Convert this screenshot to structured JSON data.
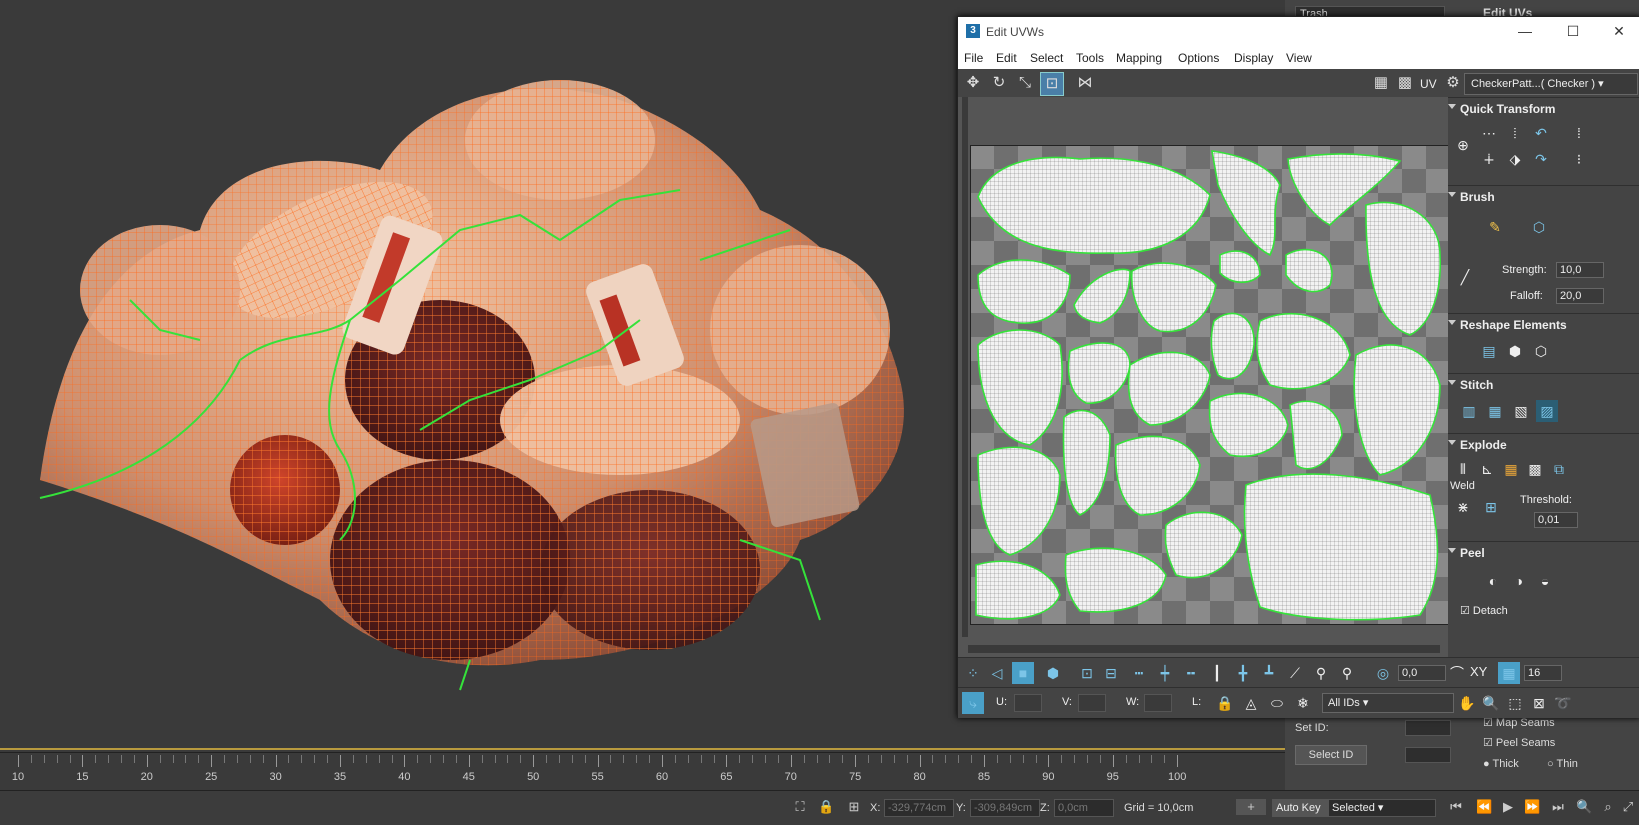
{
  "uv_window": {
    "title": "Edit UVWs",
    "app_badge": "3",
    "window_controls": {
      "minimize": "—",
      "maximize": "☐",
      "close": "✕"
    },
    "menu": [
      "File",
      "Edit",
      "Select",
      "Tools",
      "Mapping",
      "Options",
      "Display",
      "View"
    ],
    "toolbar": {
      "uv_label": "UV",
      "map_select": "CheckerPatt...( Checker )"
    },
    "rollouts": {
      "quick_transform": "Quick Transform",
      "brush": "Brush",
      "brush_strength_label": "Strength:",
      "brush_strength_value": "10,0",
      "brush_falloff_label": "Falloff:",
      "brush_falloff_value": "20,0",
      "reshape": "Reshape Elements",
      "stitch": "Stitch",
      "explode": "Explode",
      "weld": "Weld",
      "threshold_label": "Threshold:",
      "threshold_value": "0,01",
      "peel": "Peel",
      "detach": "Detach"
    },
    "bottom": {
      "soft_value": "0,0",
      "snap_count": "16",
      "u_label": "U:",
      "v_label": "V:",
      "w_label": "W:",
      "l_label": "L:",
      "ids_select": "All IDs",
      "xy_label": "XY"
    }
  },
  "command_panel": {
    "top_field": "Trash",
    "edit_uvs_header": "Edit UVs",
    "set_id_label": "Set ID:",
    "select_id_button": "Select ID",
    "map_seams": "Map Seams",
    "peel_seams": "Peel Seams",
    "thick": "Thick",
    "thin": "Thin"
  },
  "timeline": {
    "labels": [
      "10",
      "15",
      "20",
      "25",
      "30",
      "35",
      "40",
      "45",
      "50",
      "55",
      "60",
      "65",
      "70",
      "75",
      "80",
      "85",
      "90",
      "95",
      "100"
    ]
  },
  "status_bar": {
    "x_label": "X:",
    "x_value": "-329,774cm",
    "y_label": "Y:",
    "y_value": "-309,849cm",
    "z_label": "Z:",
    "z_value": "0,0cm",
    "grid": "Grid = 10,0cm",
    "auto_key": "Auto Key",
    "key_mode": "Selected"
  },
  "colors": {
    "wire_orange": "#ff6a1a",
    "seam_green": "#35e23a",
    "accent_blue": "#4aa0c8"
  }
}
